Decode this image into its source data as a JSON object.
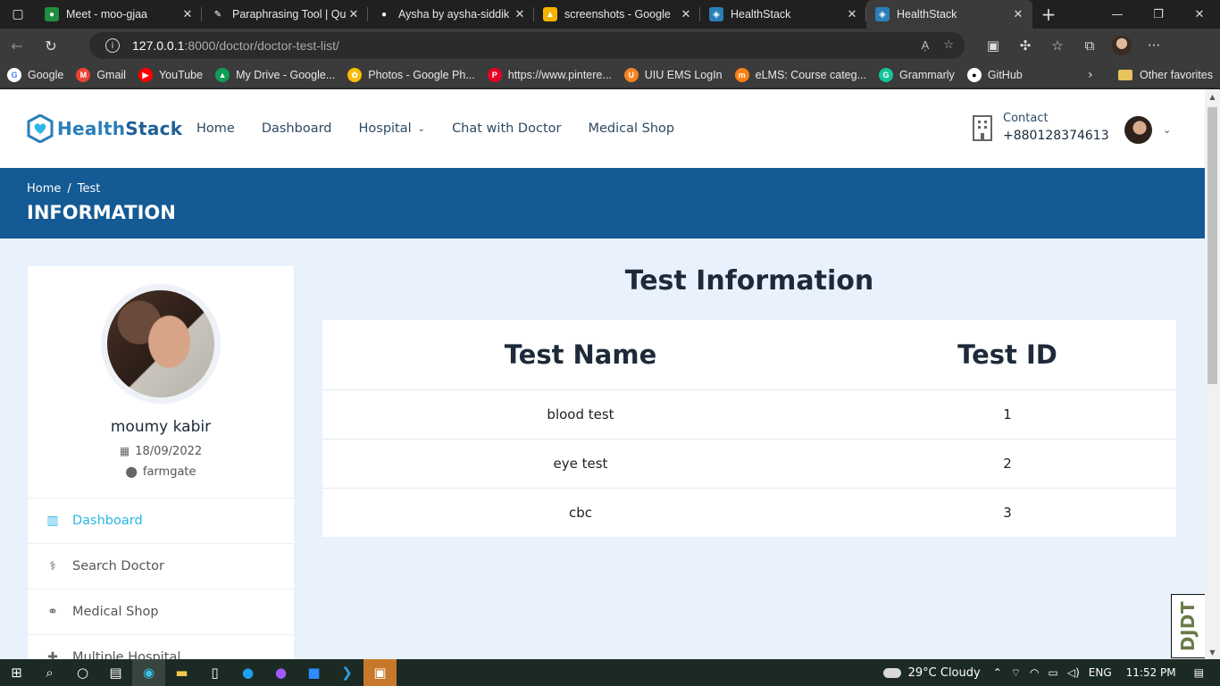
{
  "browser": {
    "tabs": [
      {
        "title": "Meet - moo-gjaa",
        "color": "#1e8e3e",
        "glyph": "●"
      },
      {
        "title": "Paraphrasing Tool | Qu",
        "color": "#202020",
        "glyph": "✎"
      },
      {
        "title": "Aysha by aysha-siddik",
        "color": "#202020",
        "glyph": "●"
      },
      {
        "title": "screenshots - Google",
        "color": "#f4b400",
        "glyph": "▲"
      },
      {
        "title": "HealthStack",
        "color": "#2a7fb8",
        "glyph": "◈"
      },
      {
        "title": "HealthStack",
        "color": "#2a7fb8",
        "glyph": "◈"
      }
    ],
    "url_host": "127.0.0.1",
    "url_rest": ":8000/doctor/doctor-test-list/",
    "bookmarks": [
      {
        "label": "Google",
        "color": "#ffffff",
        "glyph": "G",
        "fg": "#4285f4"
      },
      {
        "label": "Gmail",
        "color": "#ea4335",
        "glyph": "M",
        "fg": "#ffffff"
      },
      {
        "label": "YouTube",
        "color": "#ff0000",
        "glyph": "▶",
        "fg": "#ffffff"
      },
      {
        "label": "My Drive - Google...",
        "color": "#0f9d58",
        "glyph": "▲",
        "fg": "#ffffff"
      },
      {
        "label": "Photos - Google Ph...",
        "color": "#fbbc05",
        "glyph": "✿",
        "fg": "#ffffff"
      },
      {
        "label": "https://www.pintere...",
        "color": "#e60023",
        "glyph": "P",
        "fg": "#ffffff"
      },
      {
        "label": "UIU EMS LogIn",
        "color": "#f58220",
        "glyph": "U",
        "fg": "#ffffff"
      },
      {
        "label": "eLMS: Course categ...",
        "color": "#f98012",
        "glyph": "m",
        "fg": "#ffffff"
      },
      {
        "label": "Grammarly",
        "color": "#15c39a",
        "glyph": "G",
        "fg": "#ffffff"
      },
      {
        "label": "GitHub",
        "color": "#ffffff",
        "glyph": "●",
        "fg": "#000000"
      }
    ],
    "other_favorites": "Other favorites"
  },
  "site": {
    "logo_health": "Health",
    "logo_stack": "Stack",
    "nav": [
      "Home",
      "Dashboard",
      "Hospital",
      "Chat with Doctor",
      "Medical Shop"
    ],
    "contact_label": "Contact",
    "contact_number": "+880128374613"
  },
  "banner": {
    "crumb_home": "Home",
    "crumb_sep": "/",
    "crumb_current": "Test",
    "title": "INFORMATION"
  },
  "profile": {
    "name": "moumy kabir",
    "date": "18/09/2022",
    "location": "farmgate",
    "menu": [
      {
        "label": "Dashboard",
        "icon": "▥",
        "active": true
      },
      {
        "label": "Search Doctor",
        "icon": "⚕",
        "active": false
      },
      {
        "label": "Medical Shop",
        "icon": "⚭",
        "active": false
      },
      {
        "label": "Multiple Hospital",
        "icon": "✚",
        "active": false
      }
    ]
  },
  "tests": {
    "title": "Test Information",
    "headers": [
      "Test Name",
      "Test ID"
    ],
    "rows": [
      [
        "blood test",
        "1"
      ],
      [
        "eye test",
        "2"
      ],
      [
        "cbc",
        "3"
      ]
    ]
  },
  "debug_toolbar": "DJDT",
  "taskbar": {
    "weather": "29°C  Cloudy",
    "lang": "ENG",
    "time": "11:52 PM"
  }
}
